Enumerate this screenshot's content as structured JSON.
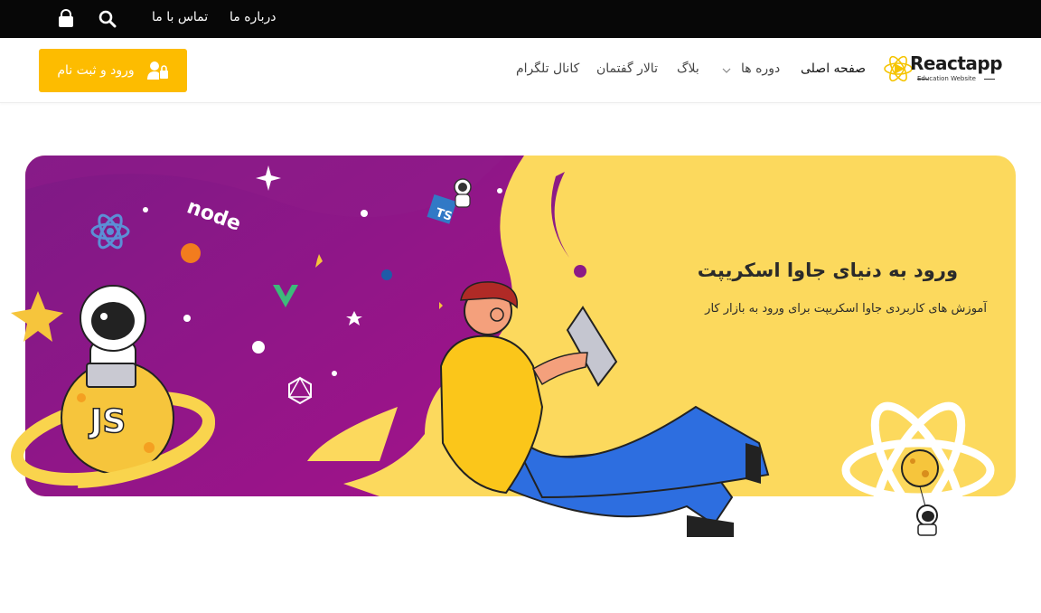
{
  "topbar": {
    "about_label": "درباره ما",
    "contact_label": "تماس با ما",
    "search_icon": "search-icon",
    "cart_icon": "shopping-bag-icon"
  },
  "header": {
    "login_label": "ورود و ثبت نام",
    "login_icon": "user-lock-icon",
    "nav": {
      "home": "صفحه اصلی",
      "courses": "دوره ها",
      "blog": "بلاگ",
      "forum": "تالار گفتمان",
      "telegram": "کانال تلگرام"
    },
    "logo": {
      "brand": "Reactapp",
      "tagline": "Education Website"
    }
  },
  "banner": {
    "title": "ورود به دنیای جاوا اسکریپت",
    "subtitle": "آموزش های کاربردی جاوا اسکریپت برای ورود به بازار کار",
    "badges": {
      "js": "JS",
      "ts": "TS",
      "node": "node"
    }
  },
  "colors": {
    "topbar_bg": "#070707",
    "accent": "#fdbc00",
    "banner_yellow": "#fcd95d",
    "banner_purple": "#8c1a86"
  }
}
